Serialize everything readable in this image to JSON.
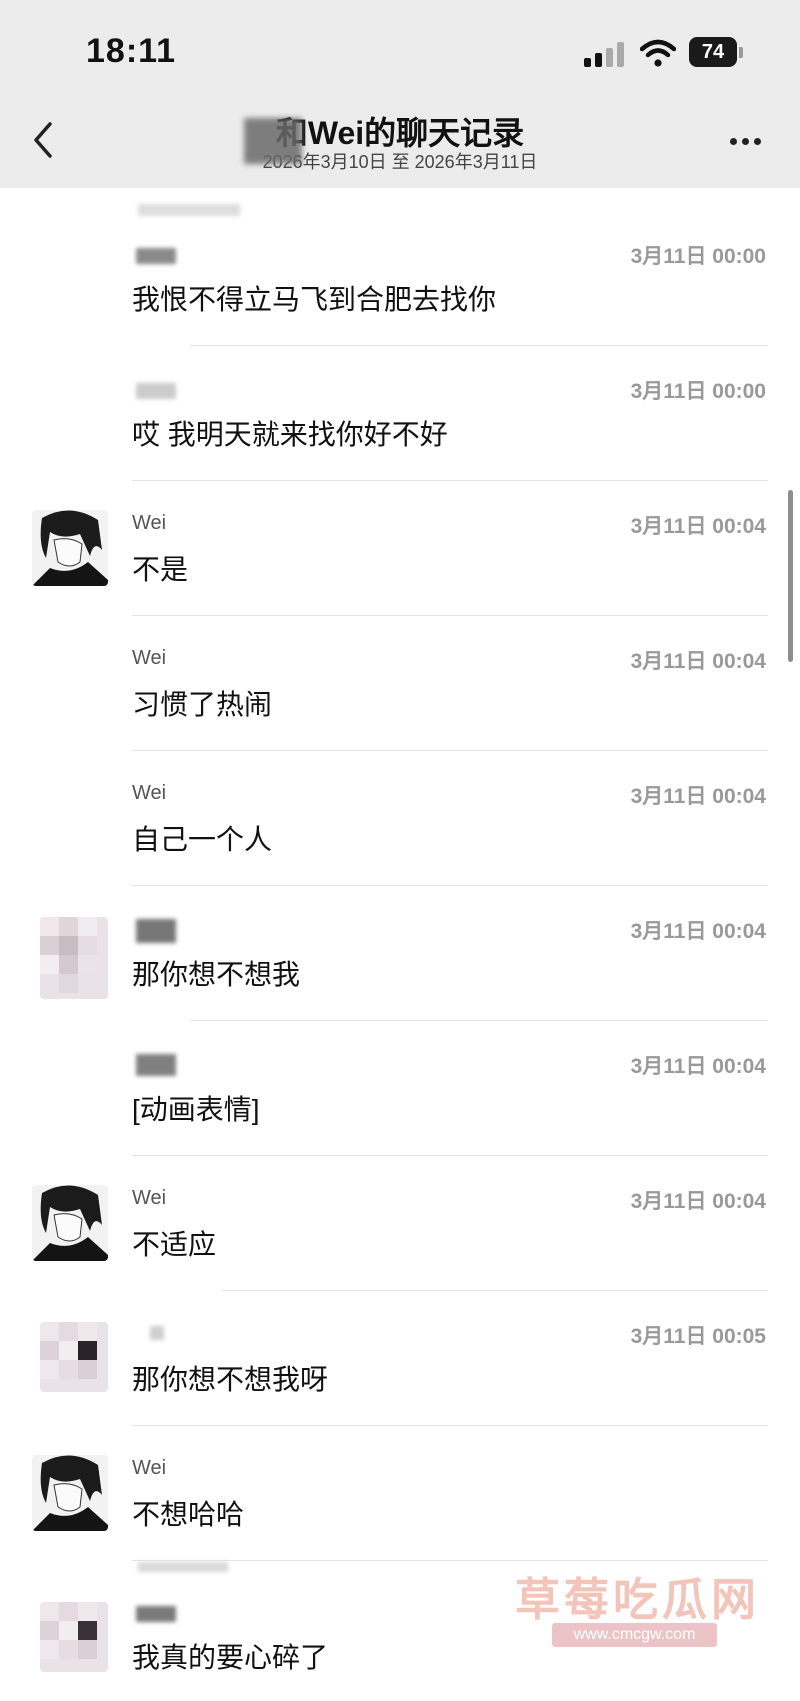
{
  "status": {
    "time": "18:11",
    "battery": "74"
  },
  "header": {
    "title": "和Wei的聊天记录",
    "subtitle": "2026年3月10日 至 2026年3月11日"
  },
  "messages": [
    {
      "sender": "",
      "time": "3月11日 00:00",
      "text": "我恨不得立马飞到合肥去找你"
    },
    {
      "sender": "",
      "time": "3月11日 00:00",
      "text": "哎 我明天就来找你好不好"
    },
    {
      "sender": "Wei",
      "time": "3月11日 00:04",
      "text": "不是"
    },
    {
      "sender": "Wei",
      "time": "3月11日 00:04",
      "text": "习惯了热闹"
    },
    {
      "sender": "Wei",
      "time": "3月11日 00:04",
      "text": "自己一个人"
    },
    {
      "sender": "",
      "time": "3月11日 00:04",
      "text": "那你想不想我"
    },
    {
      "sender": "",
      "time": "3月11日 00:04",
      "text": "[动画表情]"
    },
    {
      "sender": "Wei",
      "time": "3月11日 00:04",
      "text": "不适应"
    },
    {
      "sender": "",
      "time": "3月11日 00:05",
      "text": "那你想不想我呀"
    },
    {
      "sender": "Wei",
      "time": "",
      "text": "不想哈哈"
    },
    {
      "sender": "",
      "time": "",
      "text": "我真的要心碎了"
    }
  ],
  "watermark": {
    "text": "草莓吃瓜网",
    "url": "www.cmcgw.com"
  }
}
